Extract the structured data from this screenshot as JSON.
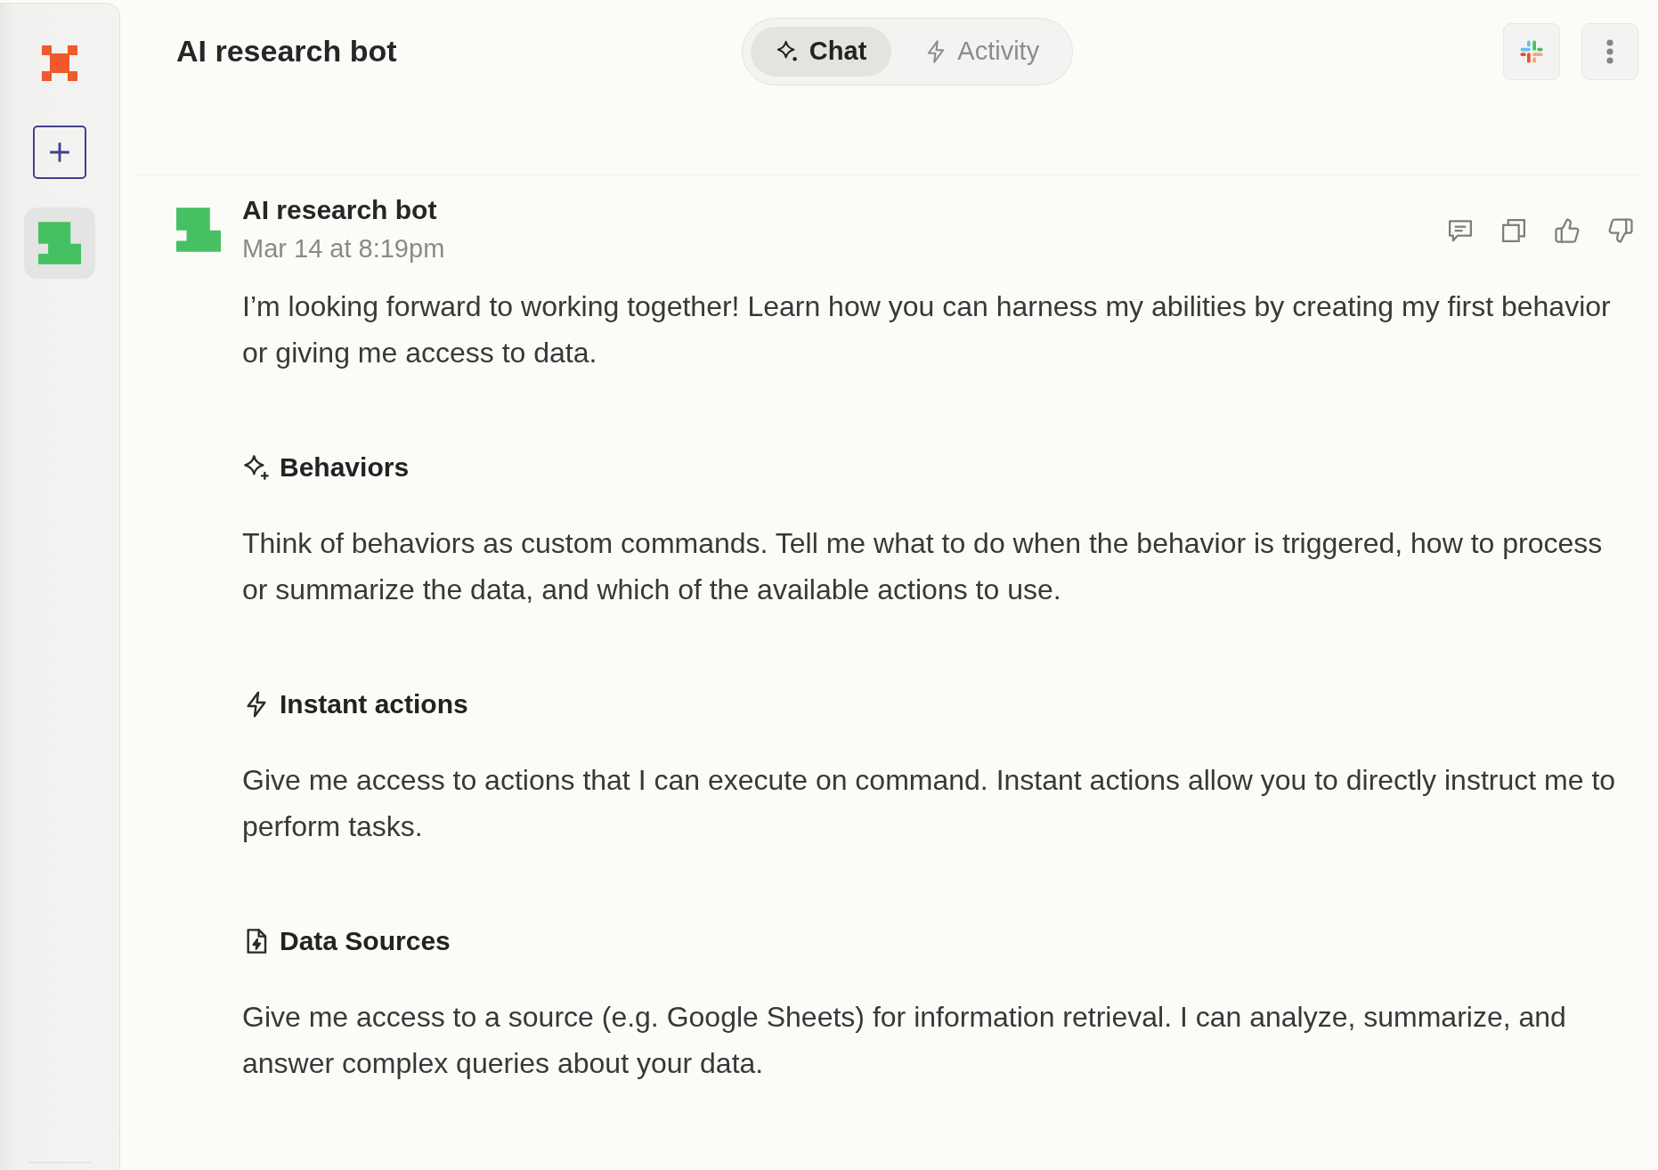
{
  "sidebar": {
    "bots": [
      {
        "selected": true
      }
    ]
  },
  "header": {
    "title": "AI research bot",
    "tabs": [
      {
        "kind": "sparkle",
        "label": "Chat",
        "selected": true
      },
      {
        "kind": "bolt",
        "label": "Activity",
        "selected": false
      }
    ]
  },
  "message": {
    "author": "AI research bot",
    "time": "Mar 14 at 8:19pm",
    "text": "I’m looking forward to working together! Learn how you can harness my abilities by creating my first behavior or giving me access to data.",
    "sections": [
      {
        "kind": "sparkle",
        "title": "Behaviors",
        "text": "Think of behaviors as custom commands. Tell me what to do when the behavior is triggered, how to process or summarize the data, and which of the available actions to use."
      },
      {
        "kind": "bolt",
        "title": "Instant actions",
        "text": "Give me access to actions that I can execute on command. Instant actions allow you to directly instruct me to perform tasks."
      },
      {
        "kind": "file",
        "title": "Data Sources",
        "text": "Give me access to a source (e.g. Google Sheets) for information retrieval. I can analyze, summarize, and answer complex queries about your data."
      }
    ]
  }
}
